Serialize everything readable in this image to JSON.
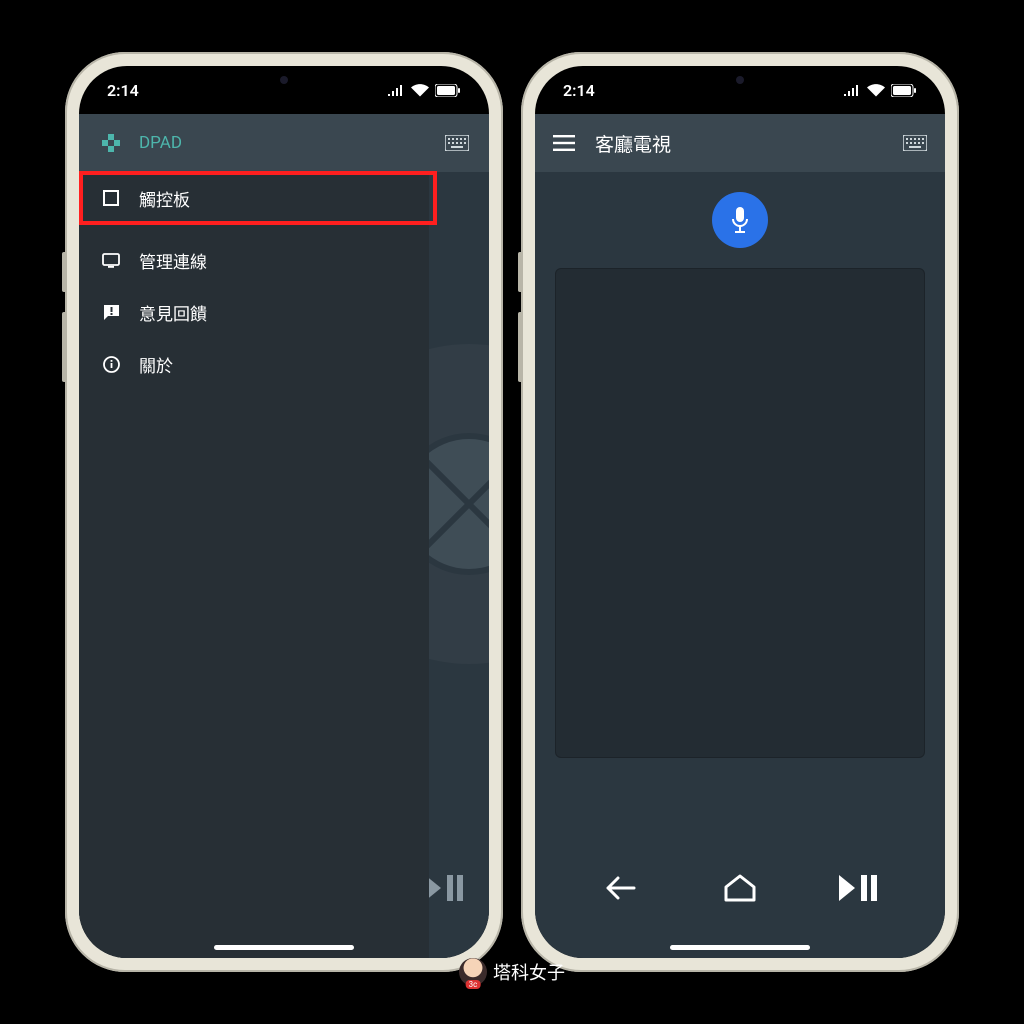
{
  "status": {
    "time": "2:14"
  },
  "left": {
    "drawer": {
      "items": [
        {
          "label": "DPAD",
          "icon": "dpad-icon",
          "active": true
        },
        {
          "label": "觸控板",
          "icon": "square-icon",
          "highlighted": true
        },
        {
          "label": "管理連線",
          "icon": "monitor-icon"
        },
        {
          "label": "意見回饋",
          "icon": "feedback-icon"
        },
        {
          "label": "關於",
          "icon": "info-icon"
        }
      ]
    }
  },
  "right": {
    "appbar": {
      "title": "客廳電視"
    }
  },
  "watermark": {
    "text": "塔科女子"
  },
  "colors": {
    "accent": "#4db6ac",
    "highlight": "#ff1f1f",
    "mic": "#2a72e8",
    "panel": "#272f35",
    "header": "#3a4750",
    "body": "#2b3740"
  }
}
